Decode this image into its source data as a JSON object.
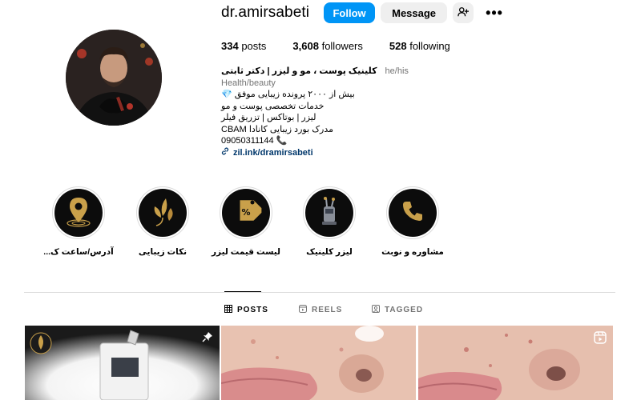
{
  "profile": {
    "username": "dr.amirsabeti",
    "follow_label": "Follow",
    "message_label": "Message",
    "more_label": "•••"
  },
  "stats": {
    "posts_count": "334",
    "posts_label": "posts",
    "followers_count": "3,608",
    "followers_label": "followers",
    "following_count": "528",
    "following_label": "following"
  },
  "bio": {
    "name": "کلینیک پوست ، مو و لیزر | دکتر ثابتی",
    "pronouns": "he/his",
    "category": "Health/beauty",
    "line1": "بیش از ۲۰۰۰ پرونده زیبایی موفق",
    "line1_emoji": "💎",
    "line2": "خدمات تخصصی پوست و مو",
    "line3": "لیزر | بوتاکس | تزریق فیلر",
    "line4": "مدرک بورد زیبایی کانادا CBAM",
    "phone": "09050311144",
    "phone_emoji": "📞",
    "link": "zil.ink/dramirsabeti"
  },
  "highlights": [
    {
      "label": "آدرس/ساعت ک...",
      "icon": "location-pin-icon"
    },
    {
      "label": "نکات زیبایی",
      "icon": "leaf-face-icon"
    },
    {
      "label": "لیست قیمت لیزر",
      "icon": "price-tag-icon"
    },
    {
      "label": "لیزر کلینیک",
      "icon": "laser-machine-icon"
    },
    {
      "label": "مشاوره و نوبت",
      "icon": "phone-icon"
    }
  ],
  "tabs": {
    "posts": "POSTS",
    "reels": "REELS",
    "tagged": "TAGGED",
    "active": "posts"
  },
  "posts": [
    {
      "type": "pinned",
      "icon": "pin-icon"
    },
    {
      "type": "image"
    },
    {
      "type": "reel",
      "icon": "reel-icon"
    }
  ],
  "colors": {
    "accent": "#0095f6",
    "link": "#00376b",
    "muted": "#737373",
    "border": "#dbdbdb",
    "gold": "#c9a04a"
  }
}
